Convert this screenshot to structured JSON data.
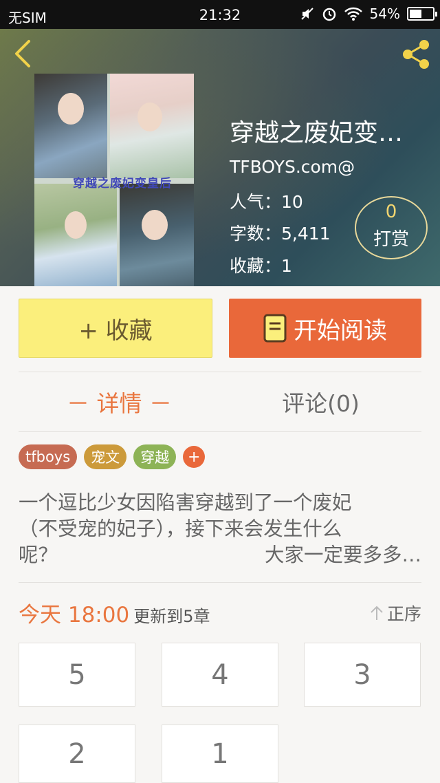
{
  "status_bar": {
    "carrier": "无SIM",
    "time": "21:32",
    "battery": "54%",
    "battery_level": 0.54
  },
  "book": {
    "title": "穿越之废妃变…",
    "author": "TFBOYS.com@",
    "cover_title": "穿越之废妃变皇后",
    "stats": {
      "popularity": "人气：10",
      "word_count": "字数：5,411",
      "favorites": "收藏：1"
    },
    "reward": {
      "count": "0",
      "label": "打赏"
    }
  },
  "actions": {
    "favorite_label": "+ 收藏",
    "read_label": "开始阅读"
  },
  "tabs": {
    "details": "－ 详情 －",
    "comments": "评论(0)"
  },
  "tags": [
    "tfboys",
    "宠文",
    "穿越"
  ],
  "tag_add": "+",
  "description": {
    "line1": "一个逗比少女因陷害穿越到了一个废妃",
    "line2": "（不受宠的妃子），接下来会发生什么",
    "line3_left": "呢？",
    "line3_right": "大家一定要多多…"
  },
  "update": {
    "when": "今天 18:00",
    "what": "更新到5章",
    "sort": "正序"
  },
  "chapters": [
    "5",
    "4",
    "3",
    "2",
    "1"
  ],
  "colors": {
    "accent": "#e9683a",
    "favorite_bg": "#fbef7c",
    "active_tab": "#e9763f"
  }
}
